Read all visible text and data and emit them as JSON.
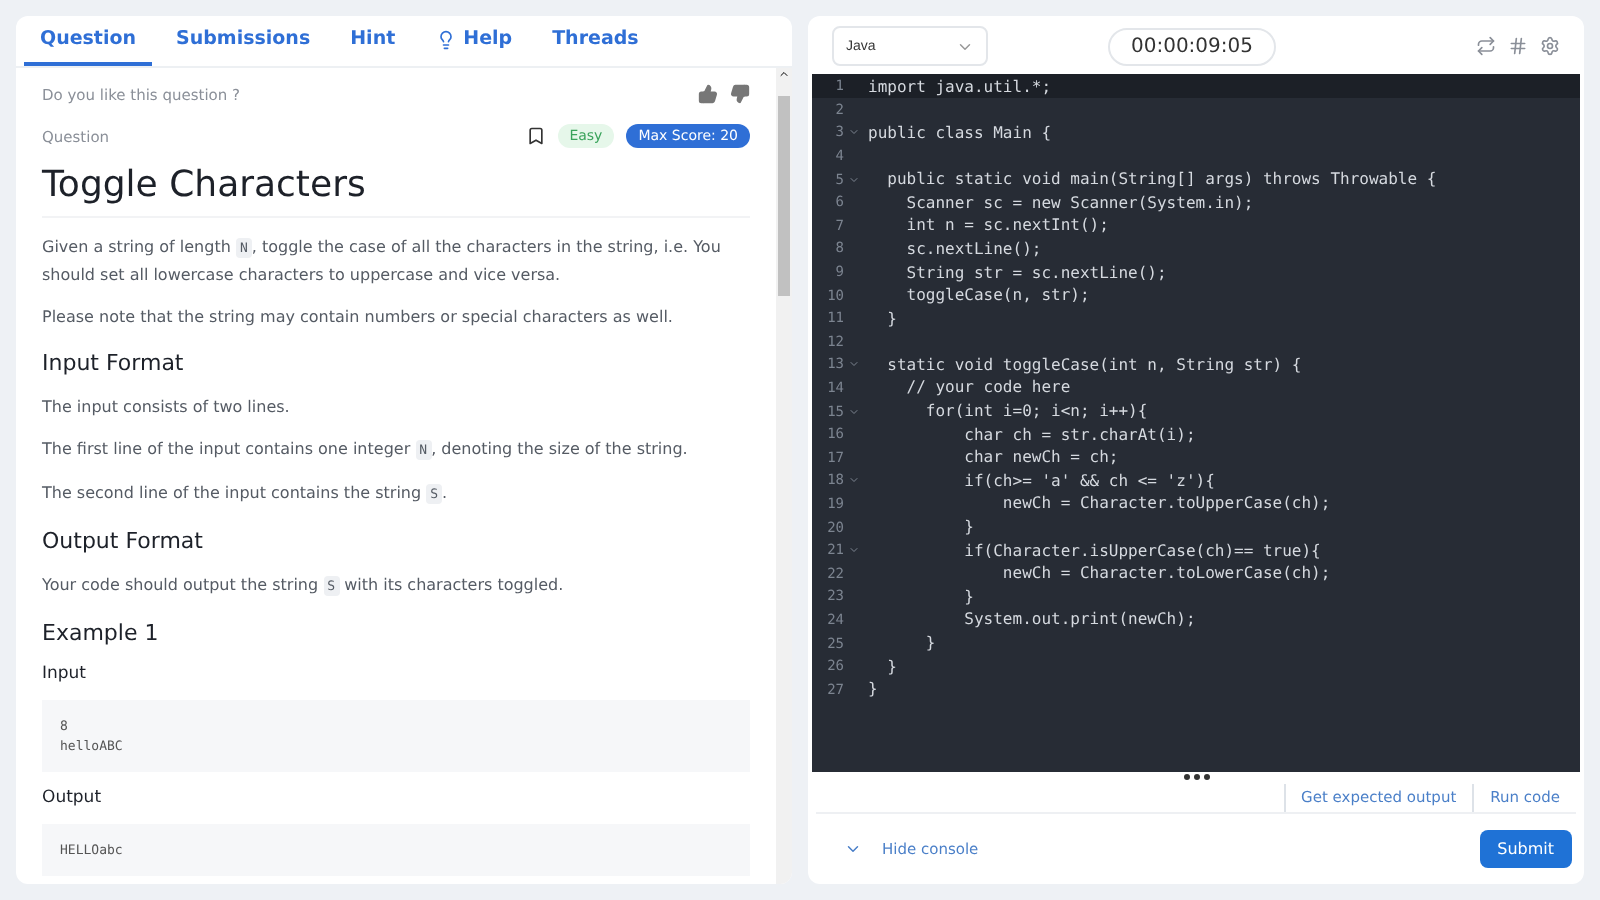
{
  "tabs": [
    {
      "label": "Question",
      "selected": true
    },
    {
      "label": "Submissions",
      "selected": false
    },
    {
      "label": "Hint",
      "selected": false
    },
    {
      "label": "Help",
      "selected": false
    },
    {
      "label": "Threads",
      "selected": false
    }
  ],
  "feedback": {
    "prompt": "Do you like this question ?"
  },
  "question": {
    "label": "Question",
    "difficulty": "Easy",
    "max_score": "Max Score: 20",
    "title": "Toggle Characters",
    "blocks": [
      {
        "kind": "para",
        "parts": [
          {
            "text": "Given a string of length ",
            "code": false
          },
          {
            "text": "N",
            "code": true
          },
          {
            "text": ", toggle the case of all the characters in the string, i.e. You should set all lowercase characters to uppercase and vice versa.",
            "code": false
          }
        ]
      },
      {
        "kind": "para",
        "parts": [
          {
            "text": "Please note that the string may contain numbers or special characters as well.",
            "code": false
          }
        ]
      },
      {
        "kind": "heading",
        "text": "Input Format"
      },
      {
        "kind": "para",
        "parts": [
          {
            "text": "The input consists of two lines.",
            "code": false
          }
        ]
      },
      {
        "kind": "para",
        "parts": [
          {
            "text": "The first line of the input contains one integer ",
            "code": false
          },
          {
            "text": "N",
            "code": true
          },
          {
            "text": ", denoting the size of the string.",
            "code": false
          }
        ]
      },
      {
        "kind": "para",
        "parts": [
          {
            "text": "The second line of the input contains the string ",
            "code": false
          },
          {
            "text": "S",
            "code": true
          },
          {
            "text": ".",
            "code": false
          }
        ]
      },
      {
        "kind": "heading",
        "text": "Output Format"
      },
      {
        "kind": "para",
        "parts": [
          {
            "text": "Your code should output the string ",
            "code": false
          },
          {
            "text": "S",
            "code": true
          },
          {
            "text": " with its characters toggled.",
            "code": false
          }
        ]
      },
      {
        "kind": "heading",
        "text": "Example 1"
      },
      {
        "kind": "subheading",
        "text": "Input"
      },
      {
        "kind": "pre",
        "lines": [
          "8",
          "helloABC"
        ]
      },
      {
        "kind": "subheading",
        "text": "Output"
      },
      {
        "kind": "pre",
        "lines": [
          "HELLOabc"
        ]
      }
    ]
  },
  "editor": {
    "language": "Java",
    "timer": "00:00:09:05",
    "lines": [
      {
        "number": "1",
        "text": "import java.util.*;",
        "foldable": false
      },
      {
        "number": "2",
        "foldable": false
      },
      {
        "number": "3",
        "text": "public class Main {",
        "foldable": true
      },
      {
        "number": "4",
        "foldable": false
      },
      {
        "number": "5",
        "text": "  public static void main(String[] args) throws Throwable {",
        "foldable": true
      },
      {
        "number": "6",
        "text": "    Scanner sc = new Scanner(System.in);",
        "foldable": false
      },
      {
        "number": "7",
        "text": "    int n = sc.nextInt();",
        "foldable": false
      },
      {
        "number": "8",
        "text": "    sc.nextLine();",
        "foldable": false
      },
      {
        "number": "9",
        "text": "    String str = sc.nextLine();",
        "foldable": false
      },
      {
        "number": "10",
        "text": "    toggleCase(n, str);",
        "foldable": false
      },
      {
        "number": "11",
        "text": "  }",
        "foldable": false
      },
      {
        "number": "12",
        "foldable": false
      },
      {
        "number": "13",
        "text": "  static void toggleCase(int n, String str) {",
        "foldable": true
      },
      {
        "number": "14",
        "text": "    // your code here",
        "foldable": false
      },
      {
        "number": "15",
        "text": "      for(int i=0; i<n; i++){",
        "foldable": true
      },
      {
        "number": "16",
        "text": "          char ch = str.charAt(i);",
        "foldable": false
      },
      {
        "number": "17",
        "text": "          char newCh = ch;",
        "foldable": false
      },
      {
        "number": "18",
        "text": "          if(ch>= 'a' && ch <= 'z'){",
        "foldable": true
      },
      {
        "number": "19",
        "text": "              newCh = Character.toUpperCase(ch);",
        "foldable": false
      },
      {
        "number": "20",
        "text": "          }",
        "foldable": false
      },
      {
        "number": "21",
        "text": "          if(Character.isUpperCase(ch)== true){",
        "foldable": true
      },
      {
        "number": "22",
        "text": "              newCh = Character.toLowerCase(ch);",
        "foldable": false
      },
      {
        "number": "23",
        "text": "          }",
        "foldable": false
      },
      {
        "number": "24",
        "text": "          System.out.print(newCh);",
        "foldable": false
      },
      {
        "number": "25",
        "text": "      }",
        "foldable": false
      },
      {
        "number": "26",
        "text": "  }",
        "foldable": false
      },
      {
        "number": "27",
        "text": "}",
        "foldable": false
      }
    ]
  },
  "console": {
    "actions": [
      "Get expected output",
      "Run code"
    ],
    "toggle": "Hide console",
    "submit": "Submit"
  }
}
